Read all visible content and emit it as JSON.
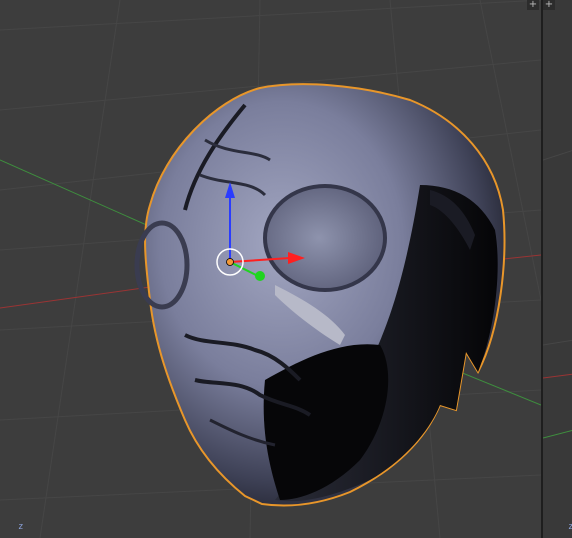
{
  "viewport": {
    "background": "#3d3d3d",
    "selected_object": "helmet-mesh",
    "selection_outline_color": "#e8962a",
    "grid_color": "#464646",
    "x_axis_color": "#9a3434",
    "y_axis_color": "#3e8e3e"
  },
  "gizmo": {
    "z_color": "#2a3cff",
    "x_color": "#ff2020",
    "y_color": "#1fd41f",
    "pivot_color": "#f29838"
  },
  "corner_widgets": {
    "left_icon": "+",
    "right_icon": "+"
  },
  "axis_labels": {
    "left": "z",
    "right": "z"
  }
}
